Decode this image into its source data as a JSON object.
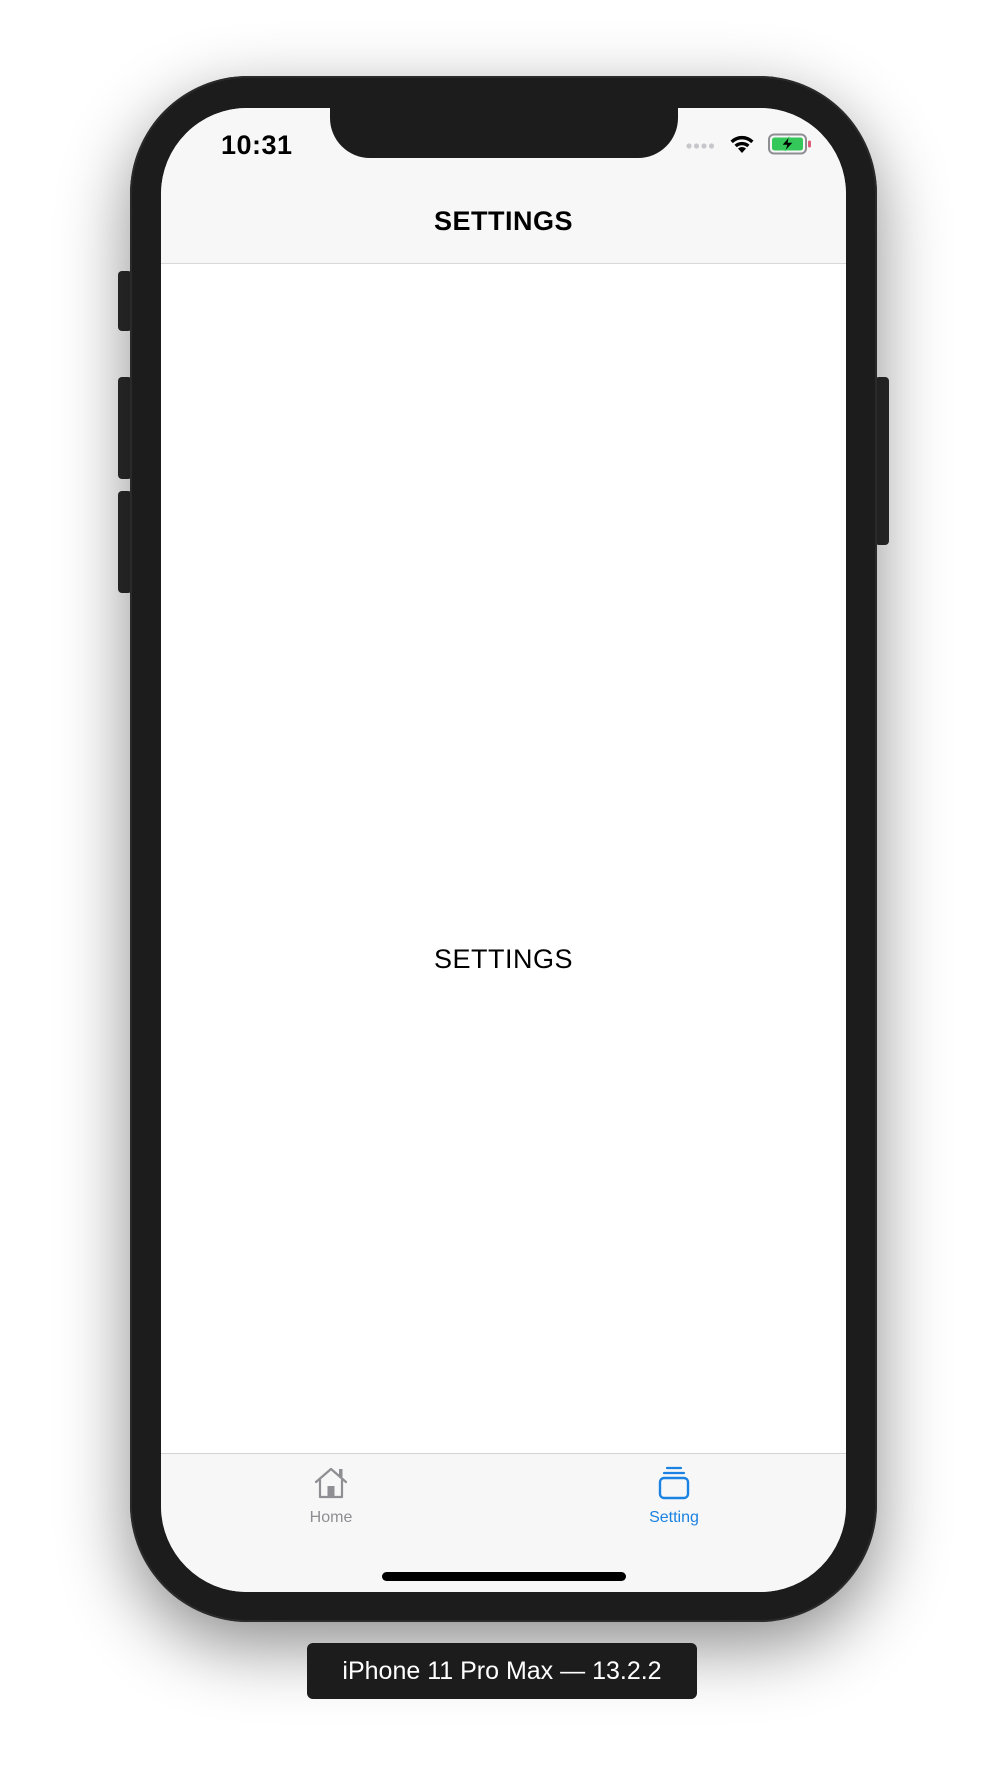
{
  "status_bar": {
    "time": "10:31"
  },
  "nav": {
    "title": "SETTINGS"
  },
  "main": {
    "label": "SETTINGS"
  },
  "tab_bar": {
    "tabs": [
      {
        "label": "Home",
        "icon": "home-icon",
        "selected": false
      },
      {
        "label": "Setting",
        "icon": "stack-icon",
        "selected": true
      }
    ]
  },
  "device_label": "iPhone 11 Pro Max — 13.2.2",
  "colors": {
    "accent": "#1a82e2",
    "inactive": "#8e8e93",
    "battery_fill": "#34c759",
    "device_frame": "#1c1c1c"
  }
}
